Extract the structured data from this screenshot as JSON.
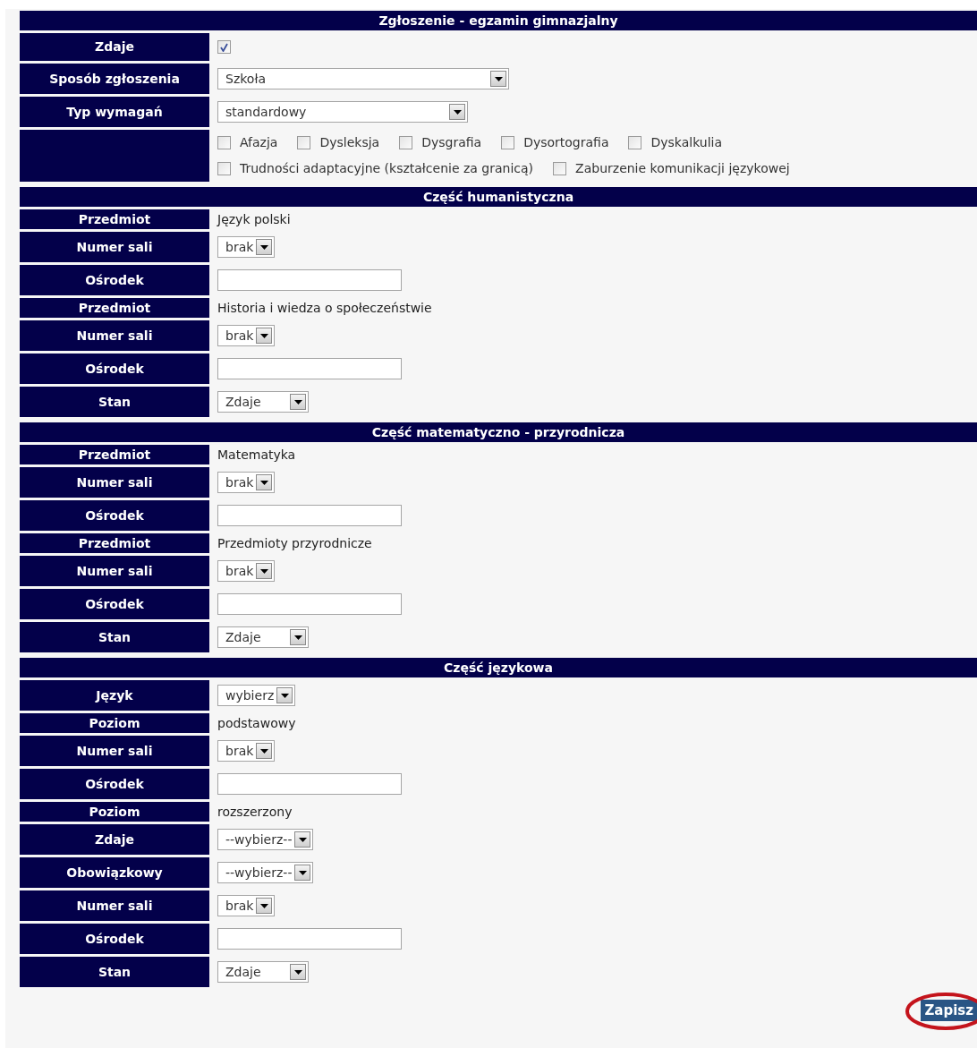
{
  "sections": [
    {
      "title": "Zgłoszenie - egzamin gimnazjalny",
      "rows": [
        {
          "kind": "checkbox",
          "label": "Zdaje",
          "checked": true
        },
        {
          "kind": "select",
          "label": "Sposób zgłoszenia",
          "value": "Szkoła"
        },
        {
          "kind": "select",
          "label": "Typ wymagań",
          "value": "standardowy"
        },
        {
          "kind": "checkboxes",
          "options": [
            {
              "label": "Afazja",
              "checked": false
            },
            {
              "label": "Dysleksja",
              "checked": false
            },
            {
              "label": "Dysgrafia",
              "checked": false
            },
            {
              "label": "Dysortografia",
              "checked": false
            },
            {
              "label": "Dyskalkulia",
              "checked": false
            },
            {
              "label": "Trudności adaptacyjne (kształcenie za granicą)",
              "checked": false
            },
            {
              "label": "Zaburzenie komunikacji językowej",
              "checked": false
            }
          ]
        }
      ]
    },
    {
      "title": "Część humanistyczna",
      "rows": [
        {
          "kind": "text",
          "label": "Przedmiot",
          "value": "Język polski"
        },
        {
          "kind": "select",
          "label": "Numer sali",
          "value": "brak"
        },
        {
          "kind": "input",
          "label": "Ośrodek"
        },
        {
          "kind": "text",
          "label": "Przedmiot",
          "value": "Historia i wiedza o społeczeństwie"
        },
        {
          "kind": "select",
          "label": "Numer sali",
          "value": "brak"
        },
        {
          "kind": "input",
          "label": "Ośrodek"
        },
        {
          "kind": "select",
          "label": "Stan",
          "value": "Zdaje"
        }
      ]
    },
    {
      "title": "Część matematyczno - przyrodnicza",
      "rows": [
        {
          "kind": "text",
          "label": "Przedmiot",
          "value": "Matematyka"
        },
        {
          "kind": "select",
          "label": "Numer sali",
          "value": "brak"
        },
        {
          "kind": "input",
          "label": "Ośrodek"
        },
        {
          "kind": "text",
          "label": "Przedmiot",
          "value": "Przedmioty przyrodnicze"
        },
        {
          "kind": "select",
          "label": "Numer sali",
          "value": "brak"
        },
        {
          "kind": "input",
          "label": "Ośrodek"
        },
        {
          "kind": "select",
          "label": "Stan",
          "value": "Zdaje"
        }
      ]
    },
    {
      "title": "Część językowa",
      "rows": [
        {
          "kind": "select",
          "label": "Język",
          "value": "wybierz"
        },
        {
          "kind": "text",
          "label": "Poziom",
          "value": "podstawowy"
        },
        {
          "kind": "select",
          "label": "Numer sali",
          "value": "brak"
        },
        {
          "kind": "input",
          "label": "Ośrodek"
        },
        {
          "kind": "text",
          "label": "Poziom",
          "value": "rozszerzony"
        },
        {
          "kind": "select",
          "label": "Zdaje",
          "value": "--wybierz--"
        },
        {
          "kind": "select",
          "label": "Obowiązkowy",
          "value": "--wybierz--"
        },
        {
          "kind": "select",
          "label": "Numer sali",
          "value": "brak"
        },
        {
          "kind": "input",
          "label": "Ośrodek"
        },
        {
          "kind": "select",
          "label": "Stan",
          "value": "Zdaje"
        }
      ]
    }
  ],
  "save_button": "Zapisz"
}
